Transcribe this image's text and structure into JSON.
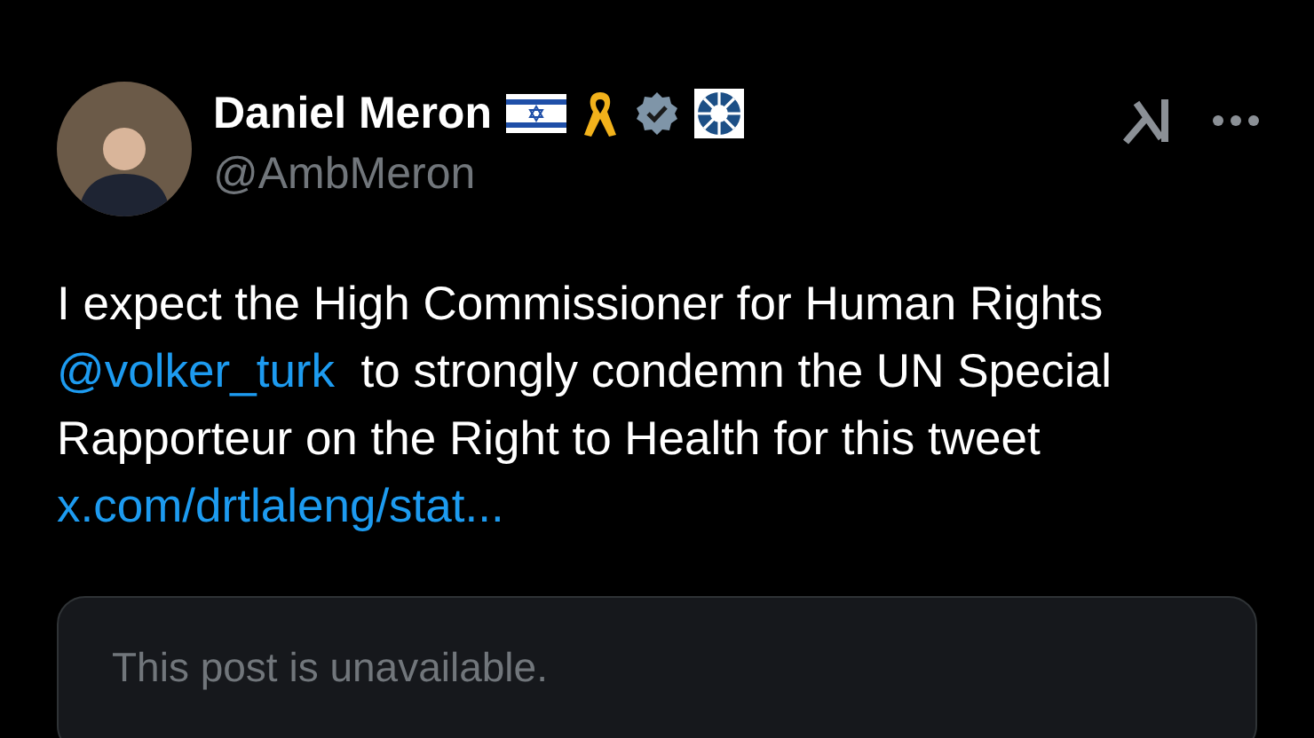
{
  "author": {
    "name": "Daniel Meron",
    "handle": "@AmbMeron"
  },
  "body": [
    {
      "kind": "text",
      "text": "I expect the High Commissioner for Human Rights "
    },
    {
      "kind": "mention",
      "text": "@volker_turk"
    },
    {
      "kind": "text",
      "text": "  to strongly condemn the UN Special Rapporteur on the Right to Health for this tweet "
    },
    {
      "kind": "link",
      "text": "x.com/drtlaleng/stat..."
    }
  ],
  "quoted_post": {
    "text": "This post is unavailable."
  }
}
